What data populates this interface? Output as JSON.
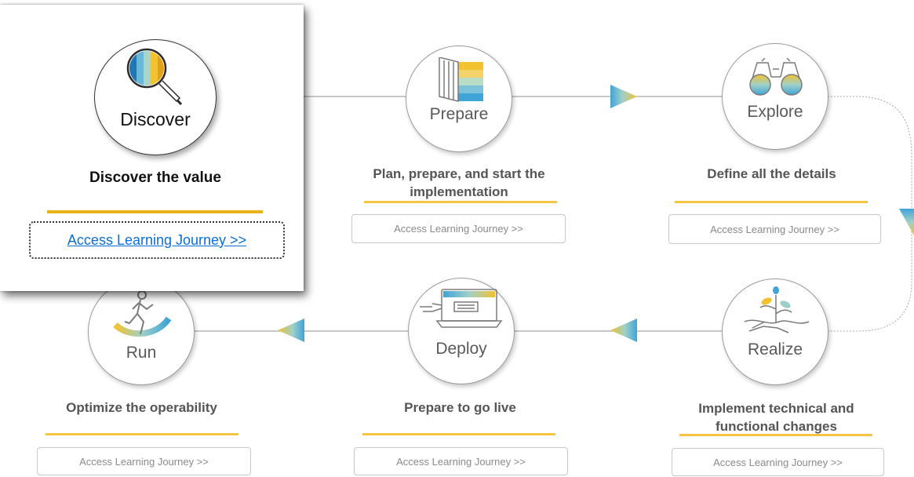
{
  "colors": {
    "accent_yellow": "#f5c546",
    "link_blue": "#0a6ed1",
    "circle_border": "#9c9c9c",
    "text_gray": "#555555"
  },
  "phases": {
    "discover": {
      "circle_label": "Discover",
      "description": "Discover the value",
      "link_label": "Access Learning Journey >>",
      "icon": "magnifier-icon"
    },
    "prepare": {
      "circle_label": "Prepare",
      "description": "Plan, prepare, and start the implementation",
      "link_label": "Access Learning Journey >>",
      "icon": "book-icon"
    },
    "explore": {
      "circle_label": "Explore",
      "description": "Define all the details",
      "link_label": "Access Learning Journey >>",
      "icon": "binoculars-icon"
    },
    "realize": {
      "circle_label": "Realize",
      "description": "Implement technical and functional changes",
      "link_label": "Access Learning Journey >>",
      "icon": "plant-icon"
    },
    "deploy": {
      "circle_label": "Deploy",
      "description": "Prepare to go live",
      "link_label": "Access Learning Journey >>",
      "icon": "laptop-icon"
    },
    "run": {
      "circle_label": "Run",
      "description": "Optimize the operability",
      "link_label": "Access Learning Journey >>",
      "icon": "runner-icon"
    }
  }
}
